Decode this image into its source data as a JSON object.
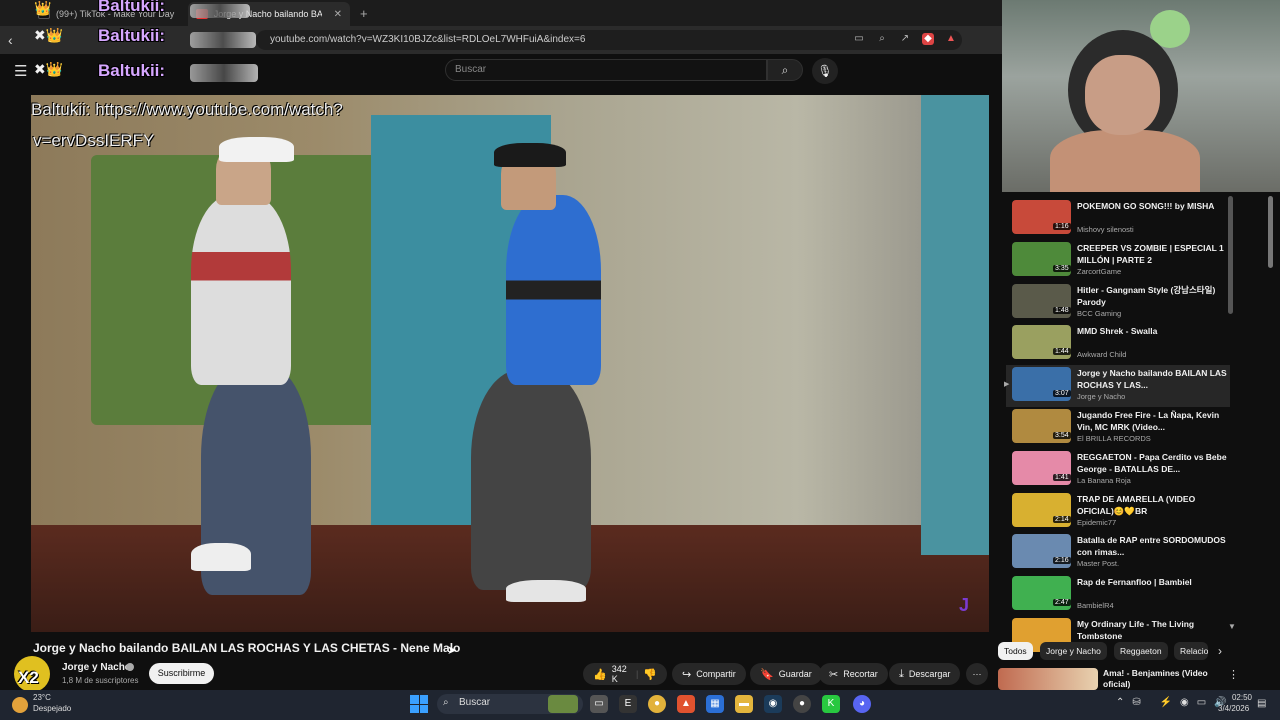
{
  "browser": {
    "tabs": [
      {
        "label": "(99+) TikTok - Make Your Day",
        "active": false
      },
      {
        "label": "Jorge y Nacho bailando BAIL...",
        "active": true
      }
    ],
    "new_tab_label": "+",
    "url": "youtube.com/watch?v=WZ3KI10BJZc&list=RDLOeL7WHFuiA&index=6"
  },
  "overlay": {
    "username": "Baltukii:",
    "chat_message_line1": "Baltukii: https://www.youtube.com/watch?",
    "chat_message_line2": "v=ervDssIERFY",
    "badge": "X2"
  },
  "youtube": {
    "search_placeholder": "Buscar",
    "video": {
      "title": "Jorge y Nacho bailando BAILAN LAS ROCHAS Y LAS CHETAS - Nene Malo",
      "channel": "Jorge y Nacho",
      "subscribers": "1,8 M de suscriptores",
      "subscribe_label": "Suscribirme",
      "likes": "342 K",
      "share_label": "Compartir",
      "save_label": "Guardar",
      "clip_label": "Recortar",
      "download_label": "Descargar",
      "more_label": "···"
    },
    "playlist": [
      {
        "title": "POKEMON GO SONG!!! by MISHA",
        "channel": "Mishovy silenosti",
        "duration": "1:16",
        "color": "#c84a3a",
        "current": false
      },
      {
        "title": "CREEPER VS ZOMBIE | ESPECIAL 1 MILLÓN | PARTE 2",
        "channel": "ZarcortGame",
        "duration": "3:35",
        "color": "#4e8a3a",
        "current": false
      },
      {
        "title": "Hitler - Gangnam Style (강남스타일) Parody",
        "channel": "BCC Gaming",
        "duration": "1:48",
        "color": "#5a5a4a",
        "current": false
      },
      {
        "title": "MMD Shrek - Swalla",
        "channel": "Awkward Child",
        "duration": "1:44",
        "color": "#9aa060",
        "current": false
      },
      {
        "title": "Jorge y Nacho bailando BAILAN LAS ROCHAS Y LAS...",
        "channel": "Jorge y Nacho",
        "duration": "3:07",
        "color": "#3a6fa8",
        "current": true
      },
      {
        "title": "Jugando Free Fire - La Ñapa, Kevin Vin, MC MRK (Video...",
        "channel": "El BRILLA RECORDS",
        "duration": "3:54",
        "color": "#b08a40",
        "current": false
      },
      {
        "title": "REGGAETON - Papa Cerdito vs Bebe George - BATALLAS DE...",
        "channel": "La Banana Roja",
        "duration": "1:41",
        "color": "#e58aa8",
        "current": false
      },
      {
        "title": "TRAP DE AMARELLA (VIDEO OFICIAL)😊💛BR",
        "channel": "Epidemic77",
        "duration": "2:14",
        "color": "#d8b030",
        "current": false
      },
      {
        "title": "Batalla de RAP entre SORDOMUDOS con rimas...",
        "channel": "Master Post.",
        "duration": "2:16",
        "color": "#6a8ab0",
        "current": false
      },
      {
        "title": "Rap de Fernanfloo | Bambiel",
        "channel": "BambielR4",
        "duration": "2:47",
        "color": "#40b050",
        "current": false
      },
      {
        "title": "My Ordinary Life - The Living Tombstone",
        "channel": "",
        "duration": "",
        "color": "#e0a030",
        "current": false
      }
    ],
    "chips": [
      {
        "label": "Todos",
        "active": true
      },
      {
        "label": "Jorge y Nacho",
        "active": false
      },
      {
        "label": "Reggaeton",
        "active": false
      },
      {
        "label": "Relacio",
        "active": false
      }
    ],
    "recommended": {
      "title": "Ama! - Benjamines (Video oficial)"
    }
  },
  "taskbar": {
    "temperature": "23°C",
    "weather": "Despejado",
    "search_label": "Buscar",
    "time": "02:50",
    "date": "3/4/2026"
  }
}
